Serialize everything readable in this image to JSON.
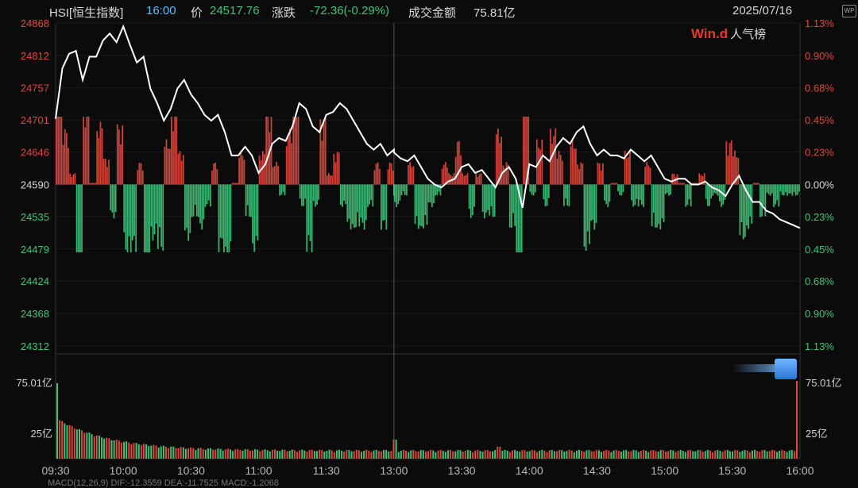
{
  "header": {
    "symbol": "HSI[恒生指数]",
    "time": "16:00",
    "price_label": "价",
    "price": "24517.76",
    "change_label": "涨跌",
    "change": "-72.36(-0.29%)",
    "turnover_label": "成交金额",
    "turnover": "75.81亿",
    "date": "2025/07/16",
    "colors": {
      "up": "#e0463c",
      "down": "#3ec47a",
      "accent": "#4fc3ff"
    }
  },
  "brand": {
    "logo": "Win.d",
    "label": "人气榜"
  },
  "icons": [
    "wp-icon",
    "cube-icon"
  ],
  "chart_data": {
    "type": "line",
    "prev_close": 24590,
    "price_axis": {
      "ticks": [
        24868,
        24812,
        24757,
        24701,
        24646,
        24590,
        24535,
        24479,
        24424,
        24368,
        24312
      ],
      "ylim": [
        24312,
        24868
      ]
    },
    "pct_axis": {
      "ticks": [
        "1.13%",
        "0.90%",
        "0.68%",
        "0.45%",
        "0.23%",
        "0.00%",
        "0.23%",
        "0.45%",
        "0.68%",
        "0.90%",
        "1.13%"
      ]
    },
    "x_ticks": [
      "09:30",
      "10:00",
      "10:30",
      "11:00",
      "11:30",
      "13:00",
      "13:30",
      "14:00",
      "14:30",
      "15:00",
      "15:30",
      "16:00"
    ],
    "price_series": {
      "x": [
        "09:30",
        "09:33",
        "09:36",
        "09:39",
        "09:42",
        "09:45",
        "09:48",
        "09:51",
        "09:54",
        "09:57",
        "10:00",
        "10:03",
        "10:06",
        "10:09",
        "10:12",
        "10:15",
        "10:18",
        "10:21",
        "10:24",
        "10:27",
        "10:30",
        "10:33",
        "10:36",
        "10:39",
        "10:42",
        "10:45",
        "10:48",
        "10:51",
        "10:54",
        "10:57",
        "11:00",
        "11:03",
        "11:06",
        "11:09",
        "11:12",
        "11:15",
        "11:18",
        "11:21",
        "11:24",
        "11:27",
        "11:30",
        "11:33",
        "11:36",
        "11:39",
        "11:42",
        "11:45",
        "11:48",
        "11:51",
        "11:54",
        "11:57",
        "12:00",
        "13:00",
        "13:03",
        "13:06",
        "13:09",
        "13:12",
        "13:15",
        "13:18",
        "13:21",
        "13:24",
        "13:27",
        "13:30",
        "13:33",
        "13:36",
        "13:39",
        "13:42",
        "13:45",
        "13:48",
        "13:51",
        "13:54",
        "13:57",
        "14:00",
        "14:03",
        "14:06",
        "14:09",
        "14:12",
        "14:15",
        "14:18",
        "14:21",
        "14:24",
        "14:27",
        "14:30",
        "14:33",
        "14:36",
        "14:39",
        "14:42",
        "14:45",
        "14:48",
        "14:51",
        "14:54",
        "14:57",
        "15:00",
        "15:03",
        "15:06",
        "15:09",
        "15:12",
        "15:15",
        "15:18",
        "15:21",
        "15:24",
        "15:27",
        "15:30",
        "15:33",
        "15:36",
        "15:39",
        "15:42",
        "15:45",
        "15:48",
        "15:51",
        "15:54",
        "15:57",
        "16:00"
      ],
      "values": [
        24703,
        24790,
        24815,
        24820,
        24770,
        24810,
        24810,
        24838,
        24850,
        24835,
        24862,
        24830,
        24800,
        24810,
        24755,
        24730,
        24700,
        24720,
        24755,
        24770,
        24745,
        24730,
        24710,
        24700,
        24710,
        24680,
        24640,
        24640,
        24655,
        24640,
        24610,
        24625,
        24660,
        24670,
        24665,
        24690,
        24730,
        24720,
        24690,
        24680,
        24710,
        24715,
        24730,
        24720,
        24700,
        24680,
        24660,
        24650,
        24660,
        24640,
        24650,
        24645,
        24635,
        24630,
        24640,
        24620,
        24600,
        24590,
        24585,
        24595,
        24600,
        24620,
        24625,
        24610,
        24615,
        24600,
        24585,
        24610,
        24620,
        24600,
        24550,
        24625,
        24620,
        24640,
        24630,
        24655,
        24670,
        24660,
        24680,
        24690,
        24660,
        24640,
        24650,
        24640,
        24640,
        24635,
        24650,
        24640,
        24630,
        24640,
        24620,
        24600,
        24595,
        24600,
        24600,
        24590,
        24590,
        24595,
        24585,
        24580,
        24570,
        24590,
        24605,
        24580,
        24560,
        24560,
        24545,
        24540,
        24530,
        24525,
        24520,
        24515
      ]
    },
    "volume_axis": {
      "ticks": [
        "75.01亿",
        "25亿"
      ],
      "top": 75.01,
      "mid": 25
    },
    "indicator_footer": "MACD(12,26,9) DIF:-12.3559 DEA:-11.7525 MACD:-1.2068"
  }
}
